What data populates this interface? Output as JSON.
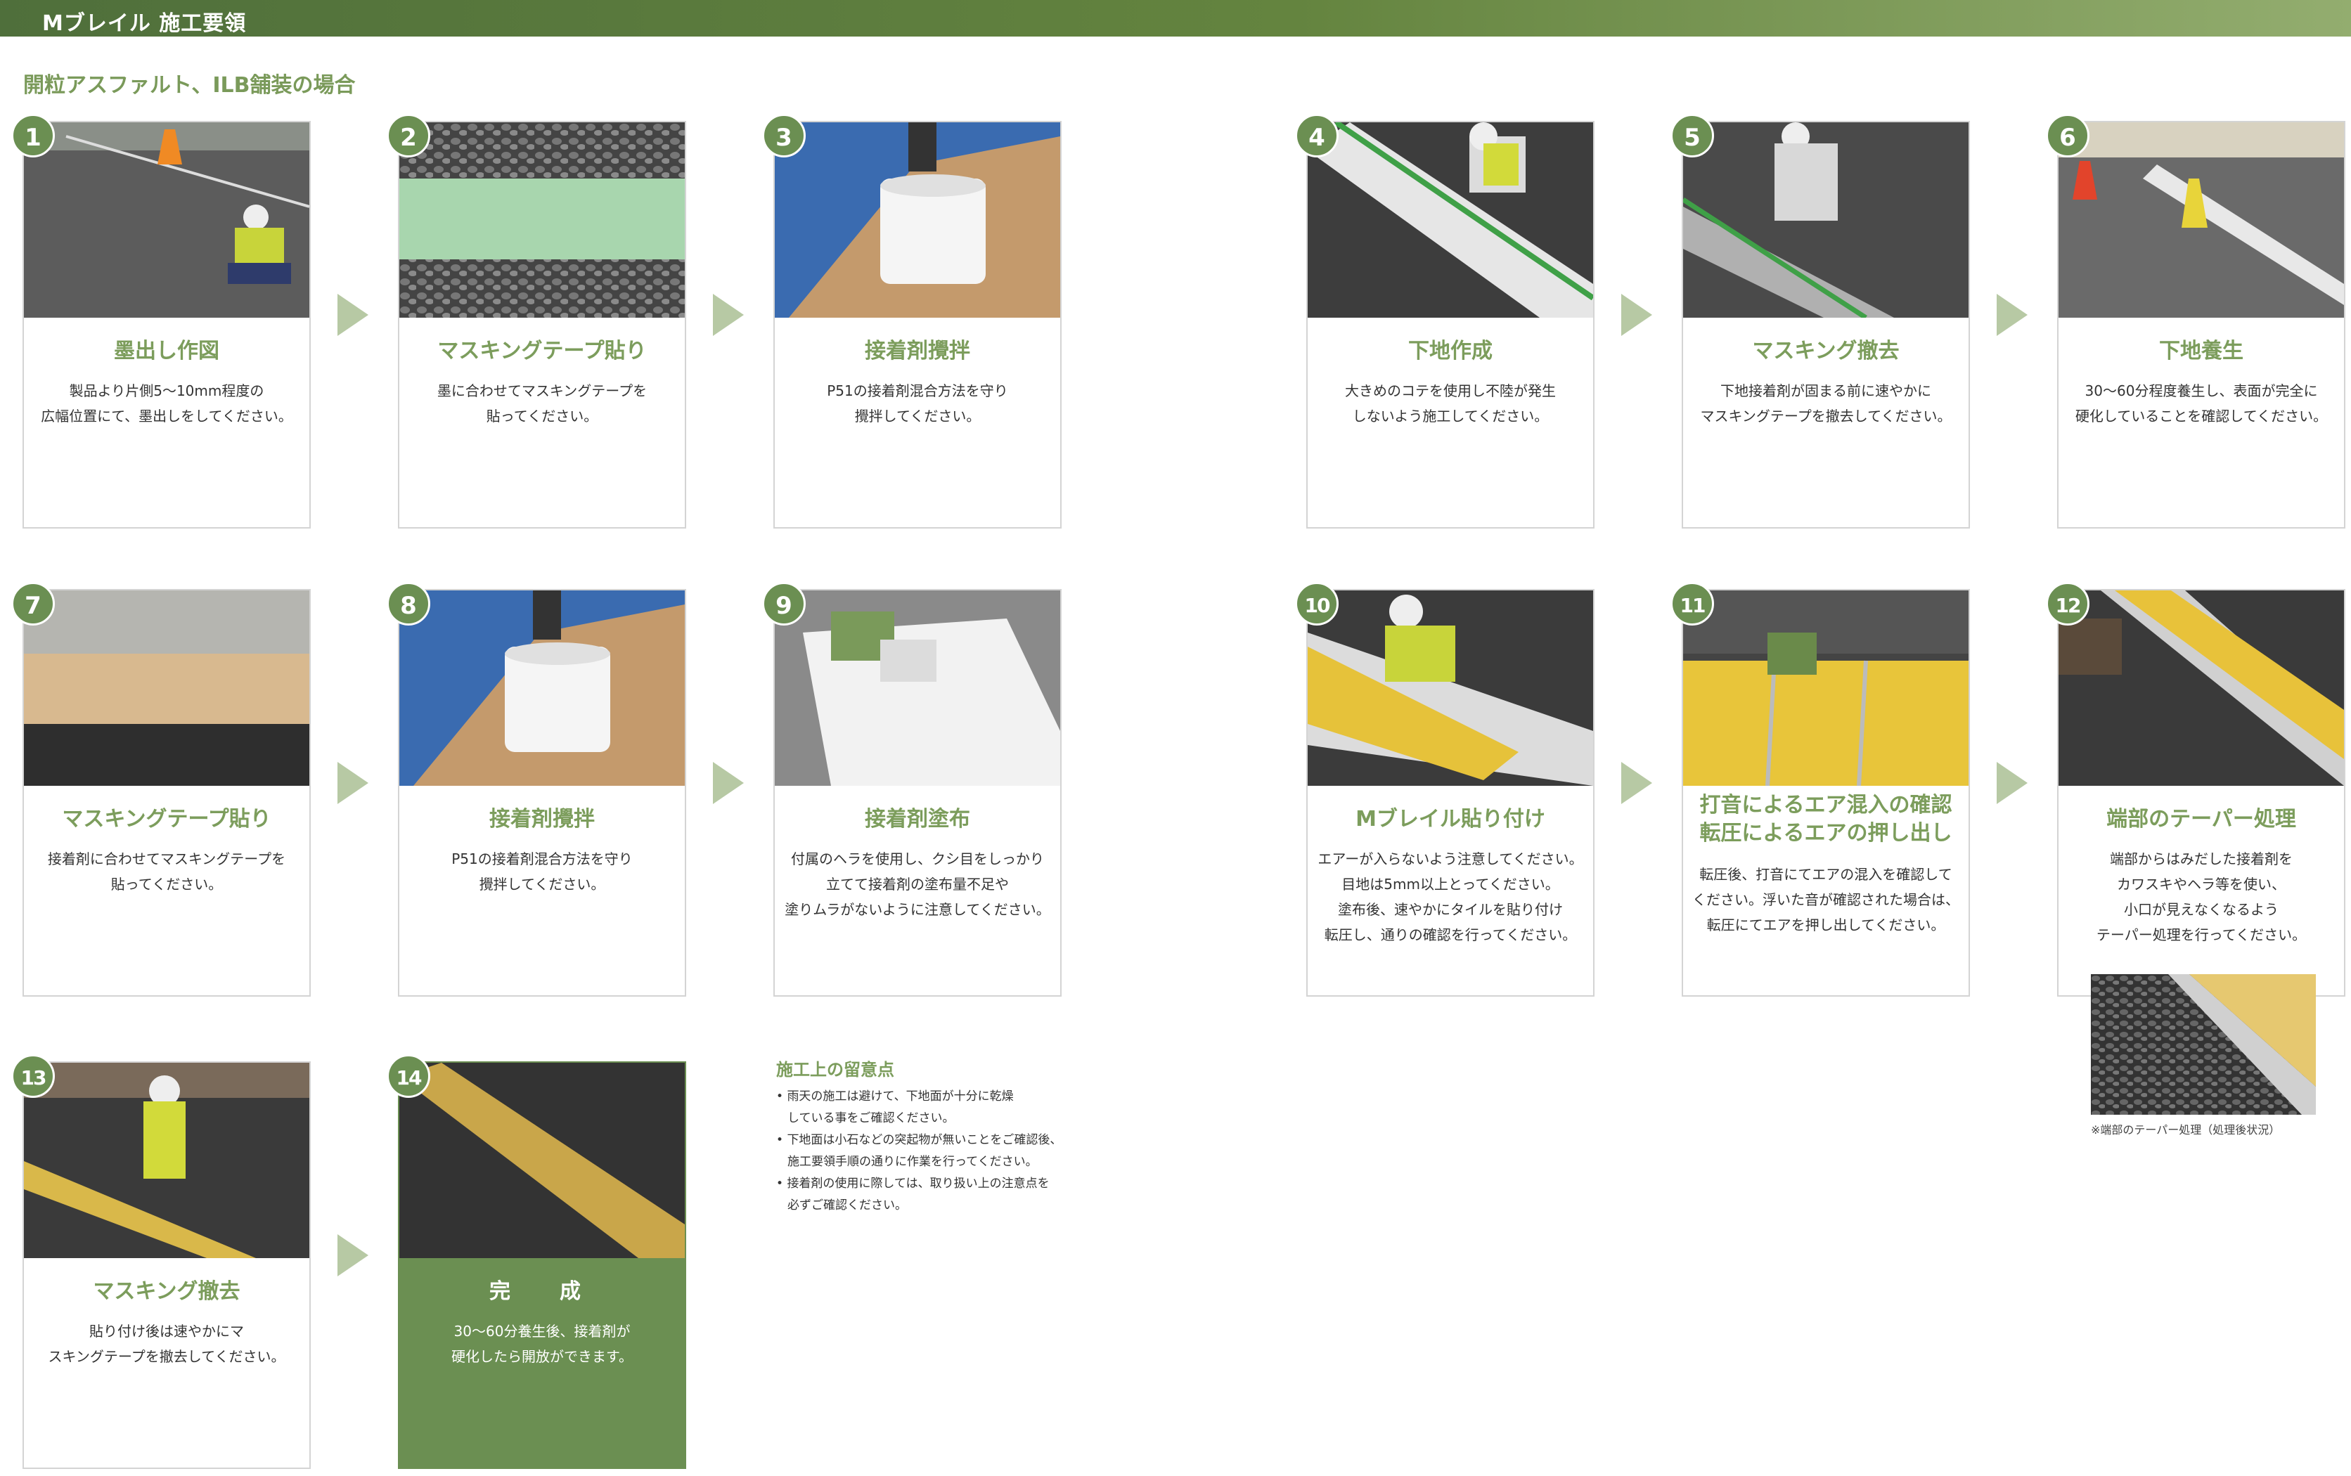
{
  "header": {
    "title": "Mブレイル 施工要領"
  },
  "section": {
    "title": "開粒アスファルト、ILB舗装の場合"
  },
  "steps": [
    {
      "num": "1",
      "title": "墨出し作図",
      "desc": "製品より片側5〜10mm程度の\n広幅位置にて、墨出しをしてください。"
    },
    {
      "num": "2",
      "title": "マスキングテープ貼り",
      "desc": "墨に合わせてマスキングテープを\n貼ってください。"
    },
    {
      "num": "3",
      "title": "接着剤攪拌",
      "desc": "P51の接着剤混合方法を守り\n攪拌してください。"
    },
    {
      "num": "4",
      "title": "下地作成",
      "desc": "大きめのコテを使用し不陸が発生\nしないよう施工してください。"
    },
    {
      "num": "5",
      "title": "マスキング撤去",
      "desc": "下地接着剤が固まる前に速やかに\nマスキングテープを撤去してください。"
    },
    {
      "num": "6",
      "title": "下地養生",
      "desc": "30〜60分程度養生し、表面が完全に\n硬化していることを確認してください。"
    },
    {
      "num": "7",
      "title": "マスキングテープ貼り",
      "desc": "接着剤に合わせてマスキングテープを\n貼ってください。"
    },
    {
      "num": "8",
      "title": "接着剤攪拌",
      "desc": "P51の接着剤混合方法を守り\n攪拌してください。"
    },
    {
      "num": "9",
      "title": "接着剤塗布",
      "desc": "付属のヘラを使用し、クシ目をしっかり\n立てて接着剤の塗布量不足や\n塗りムラがないように注意してください。"
    },
    {
      "num": "10",
      "title": "Mブレイル貼り付け",
      "desc": "エアーが入らないよう注意してください。\n目地は5mm以上とってください。\n塗布後、速やかにタイルを貼り付け\n転圧し、通りの確認を行ってください。"
    },
    {
      "num": "11",
      "title": "打音によるエア混入の確認\n転圧によるエアの押し出し",
      "desc": "転圧後、打音にてエアの混入を確認して\nください。浮いた音が確認された場合は、\n転圧にてエアを押し出してください。"
    },
    {
      "num": "12",
      "title": "端部のテーパー処理",
      "desc": "端部からはみだした接着剤を\nカワスキやヘラ等を使い、\n小口が見えなくなるよう\nテーパー処理を行ってください。"
    },
    {
      "num": "13",
      "title": "マスキング撤去",
      "desc": "貼り付け後は速やかにマ\nスキングテープを撤去してください。"
    },
    {
      "num": "14",
      "title": "完　成",
      "desc": "30〜60分養生後、接着剤が\n硬化したら開放ができます。"
    }
  ],
  "notes": {
    "title": "施工上の留意点",
    "items": [
      "雨天の施工は避けて、下地面が十分に乾燥\nしている事をご確認ください。",
      "下地面は小石などの突起物が無いことをご確認後、\n施工要領手順の通りに作業を行ってください。",
      "接着剤の使用に際しては、取り扱い上の注意点を\n必ずご確認ください。"
    ]
  },
  "taper_caption": "※端部のテーパー処理（処理後状況）",
  "colors": {
    "accent": "#6b8f52",
    "title_green": "#7c9d5c",
    "arrow": "#b7c9a4"
  }
}
